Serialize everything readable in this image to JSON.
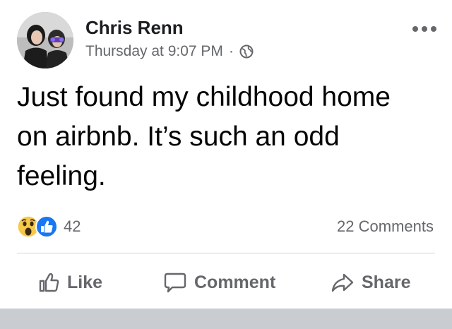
{
  "post": {
    "author": "Chris Renn",
    "timestamp": "Thursday at 9:07 PM",
    "separator": "·",
    "audience_icon": "globe-icon",
    "more_icon": "more-options-icon",
    "text": "Just found my childhood home on airbnb. It’s such an odd feeling."
  },
  "reactions": {
    "icons": [
      "wow-reaction-icon",
      "like-reaction-icon"
    ],
    "count": "42"
  },
  "comments": {
    "count_label": "22 Comments"
  },
  "actions": {
    "like_label": "Like",
    "comment_label": "Comment",
    "share_label": "Share"
  },
  "colors": {
    "text": "#050505",
    "secondary_text": "#65676b",
    "like_blue": "#1877f2",
    "wow_yellow": "#f7c94a",
    "divider": "#d3d5d8"
  }
}
